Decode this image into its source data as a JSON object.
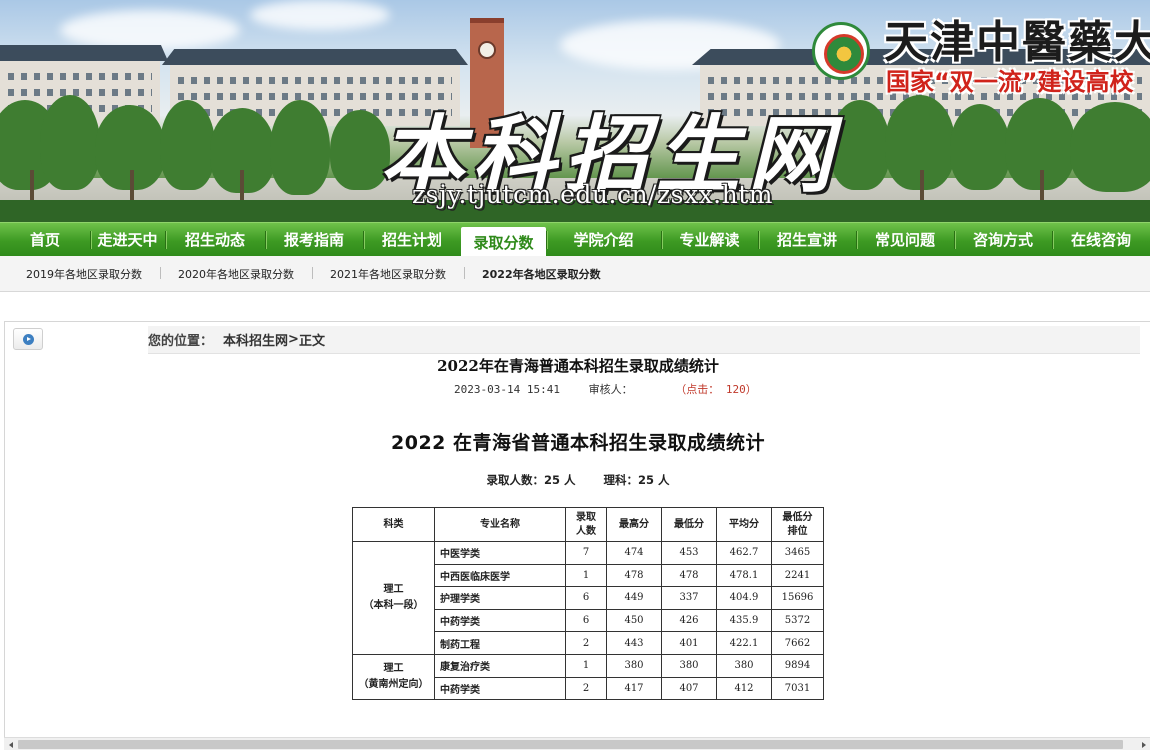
{
  "banner": {
    "site_title": "本科招生网",
    "site_url": "zsjy.tjutcm.edu.cn/zsxx.htm",
    "university_name": "天津中醫藥大學",
    "slogan": "国家“双一流”建设高校",
    "logo_icon": "university-seal-icon"
  },
  "nav": {
    "items": [
      {
        "label": "首页"
      },
      {
        "label": "走进天中"
      },
      {
        "label": "招生动态"
      },
      {
        "label": "报考指南"
      },
      {
        "label": "招生计划"
      },
      {
        "label": "录取分数",
        "active": true
      },
      {
        "label": "学院介绍"
      },
      {
        "label": "专业解读"
      },
      {
        "label": "招生宣讲"
      },
      {
        "label": "常见问题"
      },
      {
        "label": "咨询方式"
      },
      {
        "label": "在线咨询"
      }
    ],
    "accent_color": "#3d9a23"
  },
  "subnav": {
    "items": [
      {
        "label": "2019年各地区录取分数"
      },
      {
        "label": "2020年各地区录取分数"
      },
      {
        "label": "2021年各地区录取分数"
      },
      {
        "label": "2022年各地区录取分数",
        "active": true
      }
    ]
  },
  "location": {
    "label": "您的位置：",
    "home": "本科招生网",
    "separator": ">",
    "current": "正文"
  },
  "article": {
    "title": "2022年在青海普通本科招生录取成绩统计",
    "datetime": "2023-03-14 15:41",
    "reviewer_label": "审核人：",
    "clicks": "（点击： 120）"
  },
  "doc": {
    "title": "2022 在青海省普通本科招生录取成绩统计",
    "admitted": "录取人数：25 人",
    "science": "理科：25 人"
  },
  "table": {
    "headers": {
      "category": "科类",
      "major": "专业名称",
      "count": "录取人数",
      "max": "最高分",
      "min": "最低分",
      "avg": "平均分",
      "rank": "最低分排位"
    },
    "groups": [
      {
        "category_line1": "理工",
        "category_line2": "（本科一段）",
        "rows": [
          {
            "major": "中医学类",
            "count": "7",
            "max": "474",
            "min": "453",
            "avg": "462.7",
            "rank": "3465"
          },
          {
            "major": "中西医临床医学",
            "count": "1",
            "max": "478",
            "min": "478",
            "avg": "478.1",
            "rank": "2241"
          },
          {
            "major": "护理学类",
            "count": "6",
            "max": "449",
            "min": "337",
            "avg": "404.9",
            "rank": "15696"
          },
          {
            "major": "中药学类",
            "count": "6",
            "max": "450",
            "min": "426",
            "avg": "435.9",
            "rank": "5372"
          },
          {
            "major": "制药工程",
            "count": "2",
            "max": "443",
            "min": "401",
            "avg": "422.1",
            "rank": "7662"
          }
        ]
      },
      {
        "category_line1": "理工",
        "category_line2": "（黄南州定向）",
        "rows": [
          {
            "major": "康复治疗类",
            "count": "1",
            "max": "380",
            "min": "380",
            "avg": "380",
            "rank": "9894"
          },
          {
            "major": "中药学类",
            "count": "2",
            "max": "417",
            "min": "407",
            "avg": "412",
            "rank": "7031"
          }
        ]
      }
    ]
  }
}
